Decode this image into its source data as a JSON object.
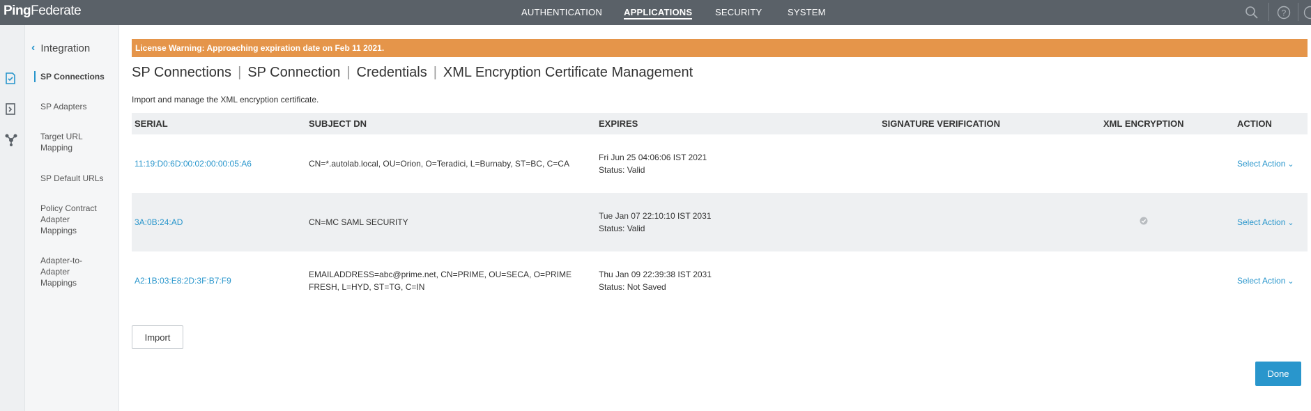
{
  "header": {
    "logo_ping": "Ping",
    "logo_federate": "Federate",
    "nav": [
      "AUTHENTICATION",
      "APPLICATIONS",
      "SECURITY",
      "SYSTEM"
    ],
    "active_nav": "APPLICATIONS",
    "icons": [
      "search-icon",
      "help-icon",
      "user-icon"
    ]
  },
  "rail": {
    "icons": [
      "sp-connections-icon",
      "sp-adapters-icon",
      "federation-icon"
    ]
  },
  "sidebar": {
    "back_label": "Integration",
    "items": [
      {
        "label": "SP Connections",
        "active": true
      },
      {
        "label": "SP Adapters",
        "active": false
      },
      {
        "label": "Target URL Mapping",
        "active": false
      },
      {
        "label": "SP Default URLs",
        "active": false
      },
      {
        "label": "Policy Contract Adapter Mappings",
        "active": false
      },
      {
        "label": "Adapter-to-Adapter Mappings",
        "active": false
      }
    ]
  },
  "warning": {
    "text": "License Warning: Approaching expiration date on Feb 11 2021."
  },
  "breadcrumb": [
    "SP Connections",
    "SP Connection",
    "Credentials",
    "XML Encryption Certificate Management"
  ],
  "description": "Import and manage the XML encryption certificate.",
  "table": {
    "headers": {
      "serial": "SERIAL",
      "subject": "SUBJECT DN",
      "expires": "EXPIRES",
      "signature": "SIGNATURE VERIFICATION",
      "encryption": "XML ENCRYPTION",
      "action": "ACTION"
    },
    "rows": [
      {
        "serial": "11:19:D0:6D:00:02:00:00:05:A6",
        "subject": "CN=*.autolab.local, OU=Orion, O=Teradici, L=Burnaby, ST=BC, C=CA",
        "expires": "Fri Jun 25 04:06:06 IST 2021",
        "status": "Status:  Valid",
        "xml_encryption": false,
        "action": "Select Action"
      },
      {
        "serial": "3A:0B:24:AD",
        "subject": "CN=MC SAML SECURITY",
        "expires": "Tue Jan 07 22:10:10 IST 2031",
        "status": "Status:  Valid",
        "xml_encryption": true,
        "action": "Select Action"
      },
      {
        "serial": "A2:1B:03:E8:2D:3F:B7:F9",
        "subject": "EMAILADDRESS=abc@prime.net, CN=PRIME, OU=SECA, O=PRIME FRESH, L=HYD, ST=TG, C=IN",
        "expires": "Thu Jan 09 22:39:38 IST 2031",
        "status": "Status:  Not Saved",
        "xml_encryption": false,
        "action": "Select Action"
      }
    ]
  },
  "buttons": {
    "import": "Import",
    "done": "Done"
  },
  "colors": {
    "topbar": "#5a6168",
    "accent": "#2996cc",
    "warning": "#e5954a"
  }
}
